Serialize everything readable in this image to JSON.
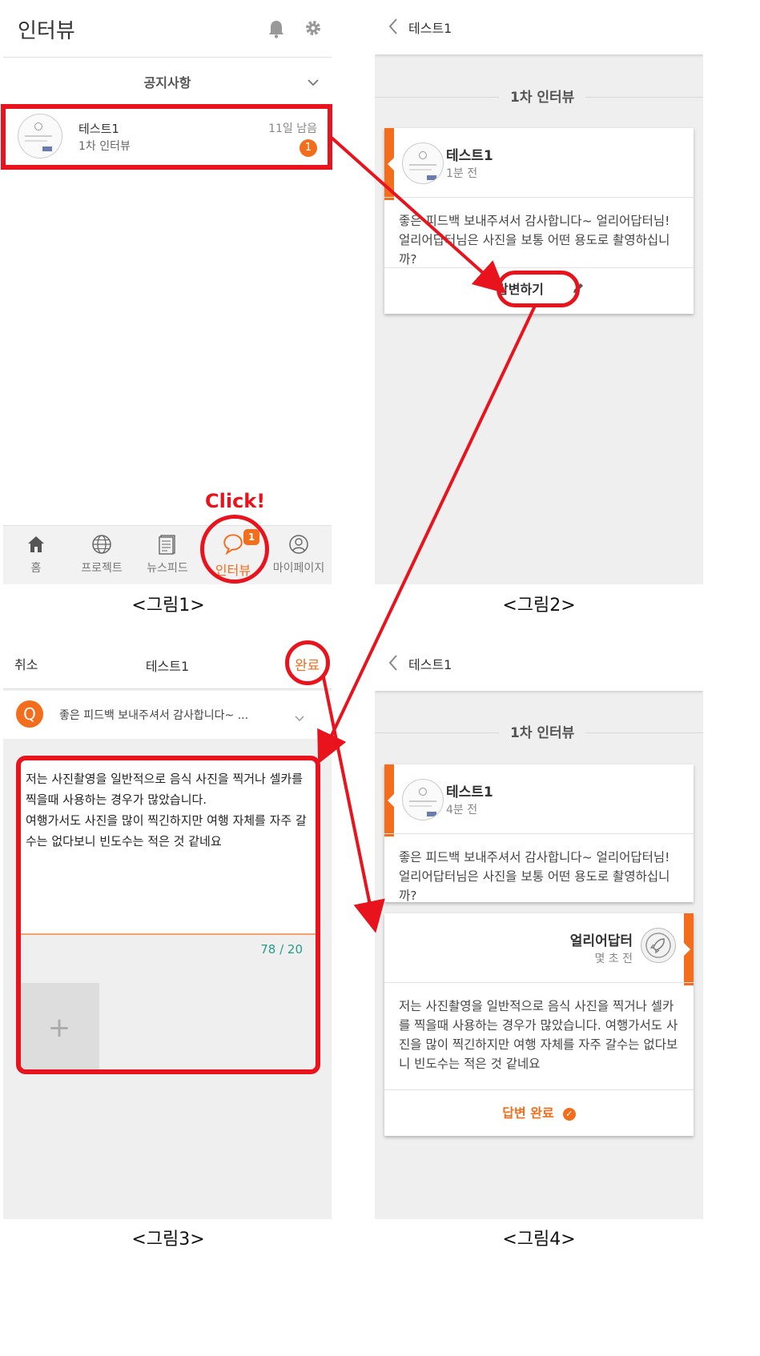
{
  "captions": [
    "<그림1>",
    "<그림2>",
    "<그림3>",
    "<그림4>"
  ],
  "click_label": "Click!",
  "colors": {
    "accent": "#f26d1c",
    "annotation": "#e8131c",
    "panel_bg": "#efefef"
  },
  "screen1": {
    "title": "인터뷰",
    "header_icons": [
      "bell-icon",
      "gear-icon"
    ],
    "notice_label": "공지사항",
    "item": {
      "title": "테스트1",
      "subtitle": "1차 인터뷰",
      "remaining": "11일 남음",
      "badge": "1"
    },
    "bottom_nav": [
      {
        "label": "홈",
        "icon": "home-icon"
      },
      {
        "label": "프로젝트",
        "icon": "globe-icon"
      },
      {
        "label": "뉴스피드",
        "icon": "newsfeed-icon"
      },
      {
        "label": "인터뷰",
        "icon": "chat-icon",
        "badge": "1",
        "active": true
      },
      {
        "label": "마이페이지",
        "icon": "profile-icon"
      }
    ]
  },
  "screen2": {
    "header_title": "테스트1",
    "section_title": "1차 인터뷰",
    "question_card": {
      "name": "테스트1",
      "time": "1분 전",
      "text": "좋은 피드백 보내주셔서 감사합니다~ 얼리어답터님! 얼리어답터님은 사진을 보통 어떤 용도로 촬영하십니까?",
      "answer_button": "답변하기"
    }
  },
  "screen3": {
    "cancel_label": "취소",
    "title": "테스트1",
    "done_label": "완료",
    "question_badge": "Q",
    "question_preview": "좋은 피드백 보내주셔서 감사합니다~ ...",
    "answer_text": "저는 사진촬영을 일반적으로 음식 사진을 찍거나 셀카를 찍을때 사용하는 경우가 많았습니다.\n여행가서도 사진을 많이 찍긴하지만 여행 자체를 자주 갈수는 없다보니 빈도수는 적은 것 같네요",
    "char_count": "78 / 20",
    "add_image_label": "+"
  },
  "screen4": {
    "header_title": "테스트1",
    "section_title": "1차 인터뷰",
    "question_card": {
      "name": "테스트1",
      "time": "4분 전",
      "text": "좋은 피드백 보내주셔서 감사합니다~ 얼리어답터님! 얼리어답터님은 사진을 보통 어떤 용도로 촬영하십니까?"
    },
    "answer_card": {
      "name": "얼리어답터",
      "time": "몇 초 전",
      "text": "저는 사진촬영을 일반적으로 음식 사진을 찍거나 셀카를 찍을때 사용하는 경우가 많았습니다. 여행가서도 사진을 많이 찍긴하지만 여행 자체를 자주 갈수는 없다보니 빈도수는 적은 것 같네요",
      "status": "답변 완료"
    }
  }
}
